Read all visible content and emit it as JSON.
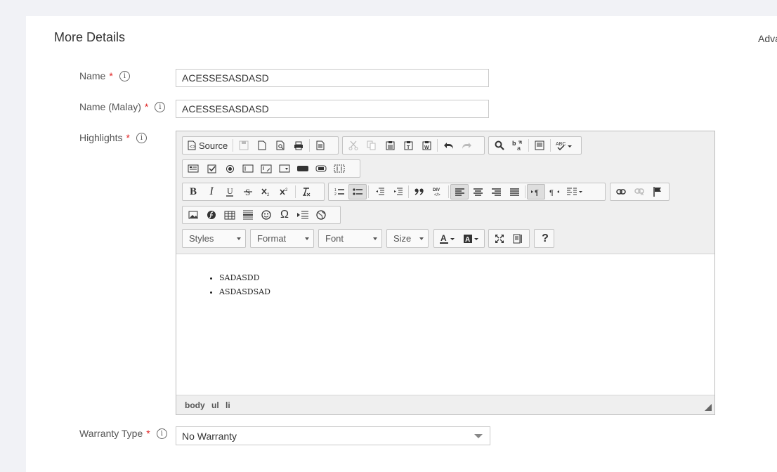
{
  "section": {
    "title": "More Details",
    "advanced_link": "Adva"
  },
  "fields": {
    "name": {
      "label": "Name",
      "required": "*",
      "value": "ACESSESASDASD"
    },
    "name_malay": {
      "label": "Name (Malay)",
      "required": "*",
      "value": "ACESSESASDASD"
    },
    "highlights": {
      "label": "Highlights",
      "required": "*"
    },
    "warranty_type": {
      "label": "Warranty Type",
      "required": "*",
      "selected": "No Warranty"
    }
  },
  "info_icon_glyph": "i",
  "editor": {
    "source_label": "Source",
    "combos": {
      "styles": "Styles",
      "format": "Format",
      "font": "Font",
      "size": "Size"
    },
    "content_items": [
      "SADASDD",
      "ASDASDSAD"
    ],
    "path": [
      "body",
      "ul",
      "li"
    ],
    "icons": [
      "source-icon",
      "save-icon",
      "new-page-icon",
      "preview-icon",
      "print-icon",
      "templates-icon",
      "cut-icon",
      "copy-icon",
      "paste-icon",
      "paste-text-icon",
      "paste-word-icon",
      "undo-icon",
      "redo-icon",
      "find-icon",
      "replace-icon",
      "select-all-icon",
      "spellcheck-icon",
      "form-icon",
      "checkbox-icon",
      "radio-icon",
      "textfield-icon",
      "textarea-icon",
      "select-icon",
      "button-icon",
      "image-button-icon",
      "hidden-field-icon",
      "bold-icon",
      "italic-icon",
      "underline-icon",
      "strike-icon",
      "subscript-icon",
      "superscript-icon",
      "remove-format-icon",
      "numbered-list-icon",
      "bulleted-list-icon",
      "outdent-icon",
      "indent-icon",
      "blockquote-icon",
      "div-icon",
      "align-left-icon",
      "align-center-icon",
      "align-right-icon",
      "justify-icon",
      "ltr-icon",
      "rtl-icon",
      "language-icon",
      "link-icon",
      "unlink-icon",
      "anchor-icon",
      "image-icon",
      "flash-icon",
      "table-icon",
      "horizontal-rule-icon",
      "smiley-icon",
      "special-char-icon",
      "page-break-icon",
      "iframe-icon",
      "text-color-icon",
      "bg-color-icon",
      "maximize-icon",
      "show-blocks-icon",
      "help-icon"
    ]
  }
}
